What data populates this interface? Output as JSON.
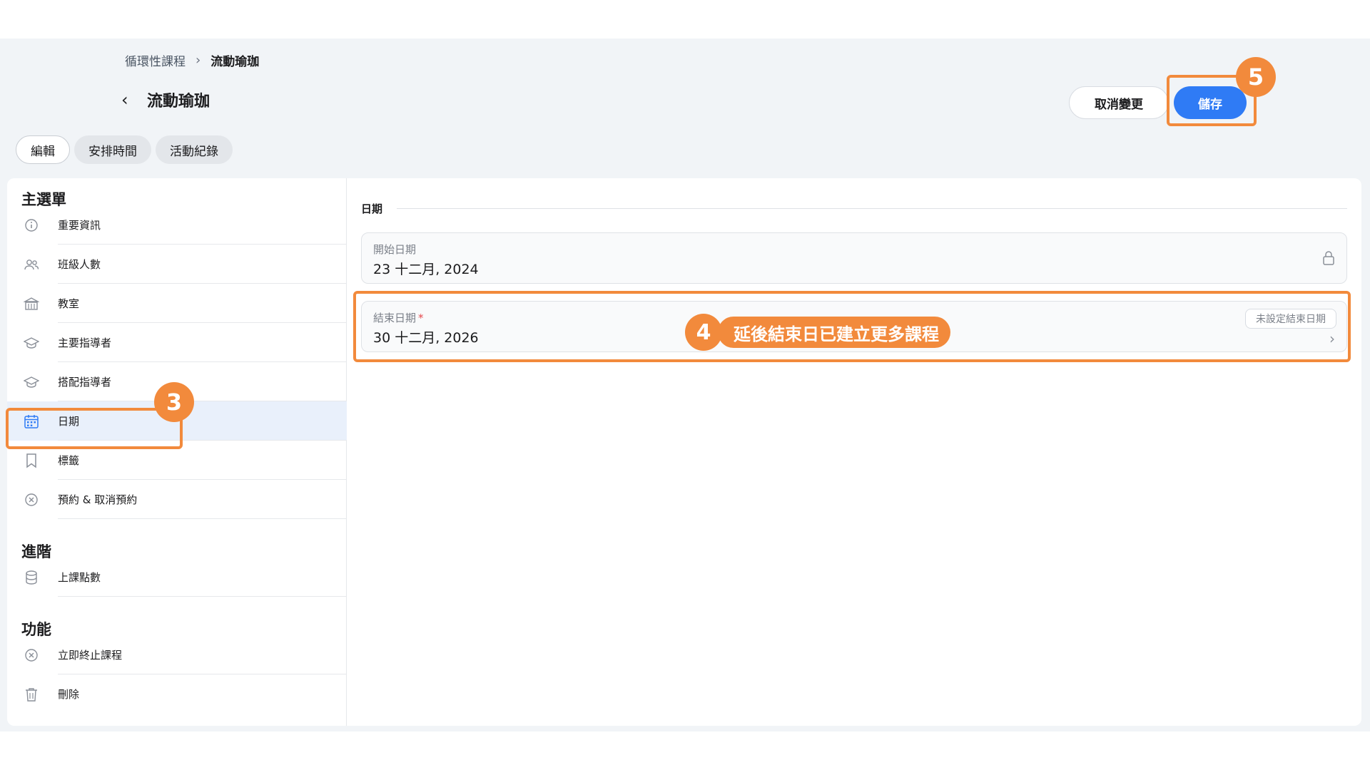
{
  "breadcrumb": {
    "parent": "循環性課程",
    "current": "流動瑜珈"
  },
  "header": {
    "title": "流動瑜珈",
    "cancel_label": "取消變更",
    "save_label": "儲存"
  },
  "tabs": [
    {
      "label": "編輯",
      "active": true
    },
    {
      "label": "安排時間",
      "active": false
    },
    {
      "label": "活動紀錄",
      "active": false
    }
  ],
  "sidebar": {
    "main_title": "主選單",
    "main_items": [
      {
        "label": "重要資訊",
        "icon": "info-icon"
      },
      {
        "label": "班級人數",
        "icon": "users-icon"
      },
      {
        "label": "教室",
        "icon": "building-icon"
      },
      {
        "label": "主要指導者",
        "icon": "graduation-cap-icon"
      },
      {
        "label": "搭配指導者",
        "icon": "graduation-cap-icon"
      },
      {
        "label": "日期",
        "icon": "calendar-icon",
        "selected": true
      },
      {
        "label": "標籤",
        "icon": "bookmark-icon"
      },
      {
        "label": "預約 & 取消預約",
        "icon": "close-circle-icon"
      }
    ],
    "advanced_title": "進階",
    "advanced_items": [
      {
        "label": "上課點數",
        "icon": "database-icon"
      }
    ],
    "function_title": "功能",
    "function_items": [
      {
        "label": "立即終止課程",
        "icon": "close-circle-icon"
      },
      {
        "label": "刪除",
        "icon": "trash-icon"
      }
    ]
  },
  "content": {
    "section_label": "日期",
    "start_date": {
      "label": "開始日期",
      "value": "23 十二月, 2024",
      "icon": "lock-icon"
    },
    "end_date": {
      "label": "結束日期",
      "required_mark": "*",
      "value": "30 十二月, 2026",
      "chip_label": "未設定結束日期",
      "icon": "chevron-right-icon"
    }
  },
  "annotations": {
    "step3": "3",
    "step4": "4",
    "step4_text": "延後結束日已建立更多課程",
    "step5": "5",
    "color": "#f28a3c"
  },
  "colors": {
    "accent": "#2f7bf5",
    "annotation": "#f28a3c",
    "background": "#f1f4f7"
  }
}
